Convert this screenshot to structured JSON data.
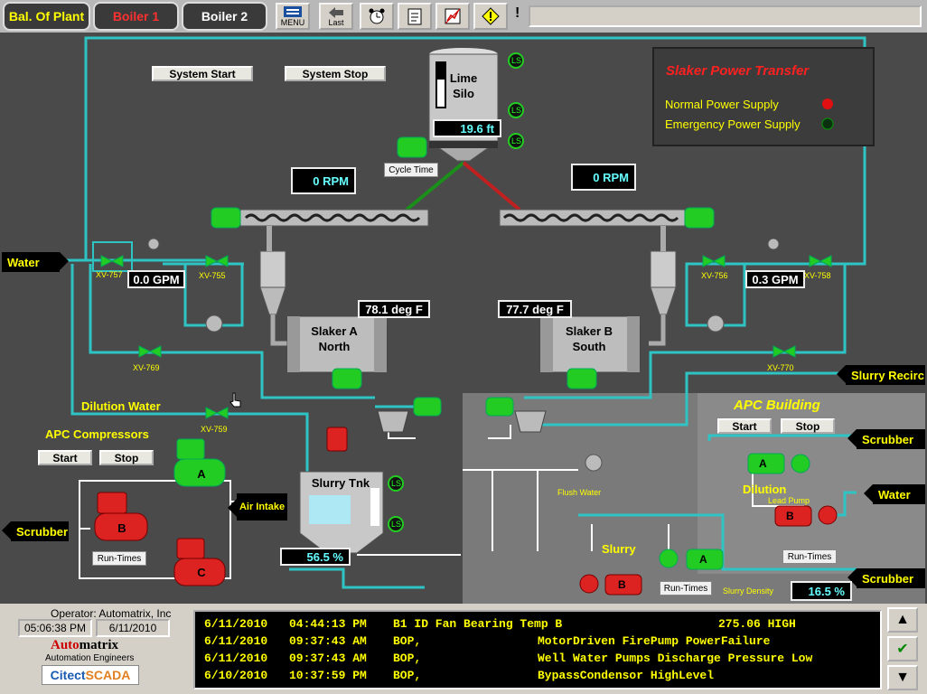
{
  "tabs": [
    {
      "label": "Bal. Of Plant",
      "color": "#ffff00"
    },
    {
      "label": "Boiler 1",
      "color": "#ff3030"
    },
    {
      "label": "Boiler 2",
      "color": "#ffffff"
    }
  ],
  "toolbar": {
    "menu": "MENU",
    "last": "Last",
    "status_mark": "!"
  },
  "plant": {
    "system_start": "System Start",
    "system_stop": "System Stop",
    "lime_silo": "Lime Silo",
    "silo_level": "19.6 ft",
    "cycle_time": "Cycle Time",
    "rpm_left": "0 RPM",
    "rpm_right": "0 RPM",
    "power_transfer_title": "Slaker Power Transfer",
    "normal_power": "Normal Power Supply",
    "emergency_power": "Emergency Power Supply",
    "water": "Water",
    "xv757": "XV-757",
    "xv755": "XV-755",
    "xv756": "XV-756",
    "xv758": "XV-758",
    "xv769": "XV-769",
    "xv770": "XV-770",
    "xv759": "XV-759",
    "gpm_left": "0.0 GPM",
    "gpm_right": "0.3 GPM",
    "temp_a": "78.1 deg F",
    "temp_b": "77.7 deg F",
    "slaker_a": "Slaker A North",
    "slaker_b": "Slaker B South",
    "slurry_recirc": "Slurry Recirc",
    "dilution_water": "Dilution Water",
    "apc_compressors": "APC Compressors",
    "start": "Start",
    "stop": "Stop",
    "air_intake": "Air Intake",
    "scrubber": "Scrubber",
    "run_times": "Run-Times",
    "slurry_tank": "Slurry Tnk",
    "tank_level": "56.5 %",
    "ls": "LS",
    "apc_building": "APC Building",
    "dilution": "Dilution",
    "lead_pump": "Lead Pump",
    "flush_water": "Flush Water",
    "slurry": "Slurry",
    "slurry_density": "Slurry Density",
    "density_value": "16.5 %",
    "comp_a": "A",
    "comp_b": "B",
    "comp_c": "C"
  },
  "footer": {
    "operator": "Operator: Automatrix, Inc",
    "time": "05:06:38 PM",
    "date": "6/11/2010",
    "brand_a": "Auto",
    "brand_b": "matrix",
    "brand_sub": "Automation Engineers",
    "citect_a": "Citect",
    "citect_b": "SCADA"
  },
  "alarms": [
    {
      "date": "6/11/2010",
      "time": "04:44:13 PM",
      "src": "B1 ID Fan Bearing Temp B",
      "desc": "",
      "val": "275.06 HIGH"
    },
    {
      "date": "6/11/2010",
      "time": "09:37:43 AM",
      "src": "BOP,",
      "desc": "MotorDriven FirePump PowerFailure",
      "val": ""
    },
    {
      "date": "6/11/2010",
      "time": "09:37:43 AM",
      "src": "BOP,",
      "desc": "Well Water Pumps Discharge Pressure Low",
      "val": ""
    },
    {
      "date": "6/10/2010",
      "time": "10:37:59 PM",
      "src": "BOP,",
      "desc": "BypassCondensor HighLevel",
      "val": ""
    }
  ],
  "colors": {
    "pipe": "#2fc4c4",
    "motor": "#22cc22",
    "alarm_text": "#ffff00",
    "readout": "#66ffff"
  },
  "icons": [
    "menu-icon",
    "last-icon",
    "alarm-clock-icon",
    "notepad-icon",
    "trend-icon",
    "warning-icon",
    "scroll-up-icon",
    "acknowledge-icon",
    "scroll-down-icon"
  ]
}
